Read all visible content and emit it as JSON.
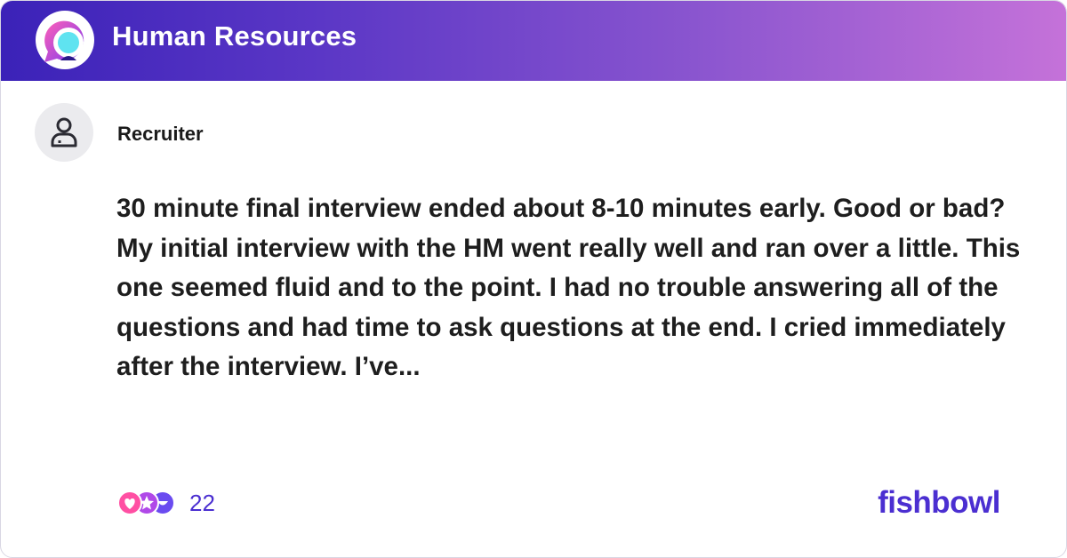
{
  "header": {
    "bowl_name": "Human Resources",
    "logo_icon": "bowl-chat-icon",
    "gradient": [
      "#3b22b8",
      "#c572d9"
    ]
  },
  "post": {
    "author": "Recruiter",
    "avatar_icon": "person-icon",
    "text": "30 minute final interview ended about 8-10 minutes early. Good or bad? My initial interview with the HM went really well and ran over a little. This one seemed fluid and to the point. I had no trouble answering all of the questions and had time to ask questions at the end. I cried immediately after the interview. I’ve...",
    "reactions": {
      "icons": [
        "heart-reaction-icon",
        "star-reaction-icon",
        "laugh-reaction-icon"
      ],
      "count": "22"
    }
  },
  "brand": {
    "name": "fishbowl",
    "color": "#4b2fd1"
  }
}
